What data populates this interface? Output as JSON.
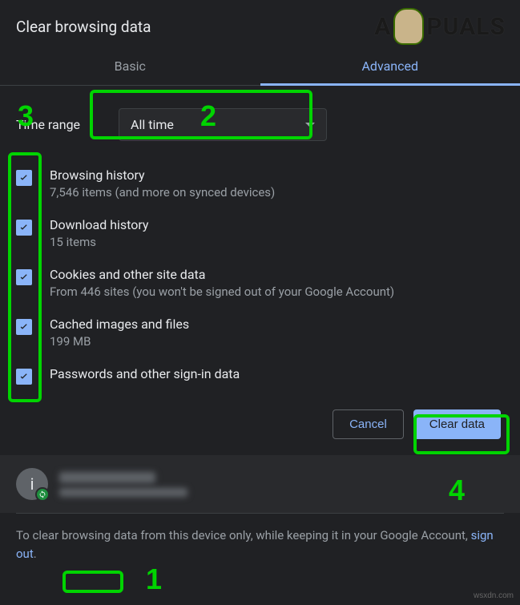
{
  "dialog": {
    "title": "Clear browsing data",
    "tabs": {
      "basic": "Basic",
      "advanced": "Advanced"
    },
    "time_range": {
      "label": "Time range",
      "value": "All time"
    },
    "options": [
      {
        "title": "Browsing history",
        "sub": "7,546 items (and more on synced devices)",
        "checked": true
      },
      {
        "title": "Download history",
        "sub": "15 items",
        "checked": true
      },
      {
        "title": "Cookies and other site data",
        "sub": "From 446 sites (you won't be signed out of your Google Account)",
        "checked": true
      },
      {
        "title": "Cached images and files",
        "sub": "199 MB",
        "checked": true
      },
      {
        "title": "Passwords and other sign-in data",
        "sub": "",
        "checked": true
      }
    ],
    "buttons": {
      "cancel": "Cancel",
      "clear": "Clear data"
    },
    "account": {
      "avatar_letter": "i"
    },
    "footer": {
      "pre": "To clear browsing data from this device only, while keeping it in your Google Account, ",
      "link": "sign out",
      "post": "."
    }
  },
  "annotations": {
    "n1": "1",
    "n2": "2",
    "n3": "3",
    "n4": "4"
  },
  "branding": {
    "logo_left": "A",
    "logo_right": "PUALS",
    "corner": "wsxdn.com"
  }
}
